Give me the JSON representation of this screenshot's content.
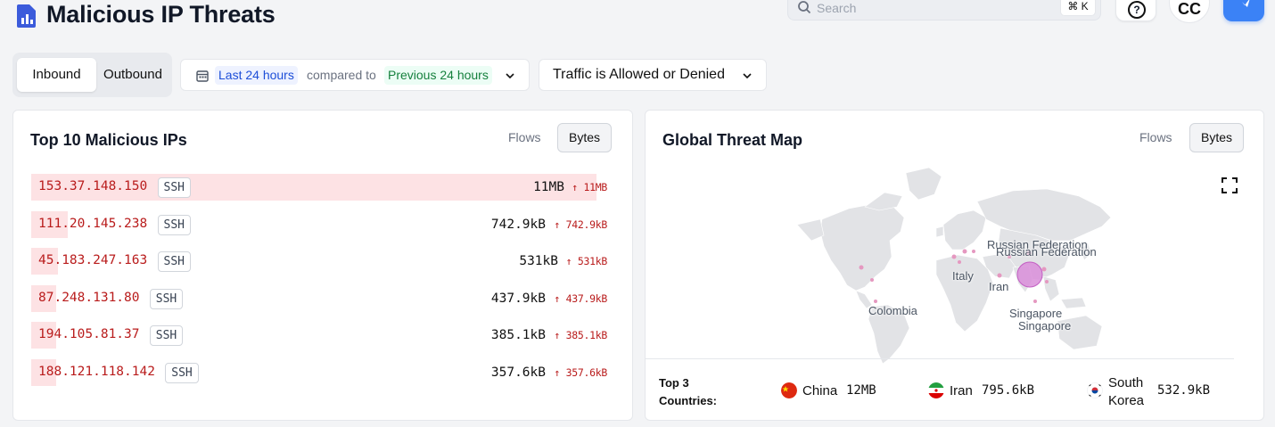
{
  "header": {
    "title": "Malicious IP Threats",
    "search_placeholder": "Search",
    "search_shortcut": "⌘ K",
    "help_glyph": "?",
    "avatar_initials": "CC"
  },
  "filters": {
    "direction_options": [
      "Inbound",
      "Outbound"
    ],
    "direction_selected": "Inbound",
    "range_current": "Last 24 hours",
    "range_compared_text": "compared to",
    "range_previous": "Previous 24 hours",
    "traffic_filter": "Traffic is Allowed or Denied"
  },
  "top_ips": {
    "title": "Top 10 Malicious IPs",
    "toggle_flows": "Flows",
    "toggle_bytes": "Bytes",
    "selected_metric": "Bytes",
    "rows": [
      {
        "ip": "153.37.148.150",
        "service": "SSH",
        "value": "11MB",
        "delta": "11MB",
        "fill": 1.0
      },
      {
        "ip": "111.20.145.238",
        "service": "SSH",
        "value": "742.9kB",
        "delta": "742.9kB",
        "fill": 0.065
      },
      {
        "ip": "45.183.247.163",
        "service": "SSH",
        "value": "531kB",
        "delta": "531kB",
        "fill": 0.047
      },
      {
        "ip": "87.248.131.80",
        "service": "SSH",
        "value": "437.9kB",
        "delta": "437.9kB",
        "fill": 0.039
      },
      {
        "ip": "194.105.81.37",
        "service": "SSH",
        "value": "385.1kB",
        "delta": "385.1kB",
        "fill": 0.034
      },
      {
        "ip": "188.121.118.142",
        "service": "SSH",
        "value": "357.6kB",
        "delta": "357.6kB",
        "fill": 0.032
      }
    ]
  },
  "threat_map": {
    "title": "Global Threat Map",
    "toggle_flows": "Flows",
    "toggle_bytes": "Bytes",
    "selected_metric": "Bytes",
    "labels": [
      "Russian Federation",
      "Russian Federation",
      "Italy",
      "Iran",
      "Colombia",
      "Singapore",
      "Singapore"
    ],
    "top3_label_line1": "Top 3",
    "top3_label_line2": "Countries:",
    "top_countries": [
      {
        "name": "China",
        "value": "12MB",
        "flag_colors": [
          "#de2910",
          "#ffde00"
        ]
      },
      {
        "name": "Iran",
        "value": "795.6kB",
        "flag_colors": [
          "#239f40",
          "#ffffff",
          "#da0000"
        ]
      },
      {
        "name_line1": "South",
        "name_line2": "Korea",
        "value": "532.9kB",
        "flag_colors": [
          "#ffffff",
          "#cd2e3a",
          "#0047a0"
        ]
      }
    ]
  },
  "colors": {
    "accent": "#3b82f6",
    "threat_red": "#b91c1c",
    "threat_bar": "#fde2e4",
    "map_bubble": "#d98ed9",
    "map_land": "#e2e3e6"
  }
}
